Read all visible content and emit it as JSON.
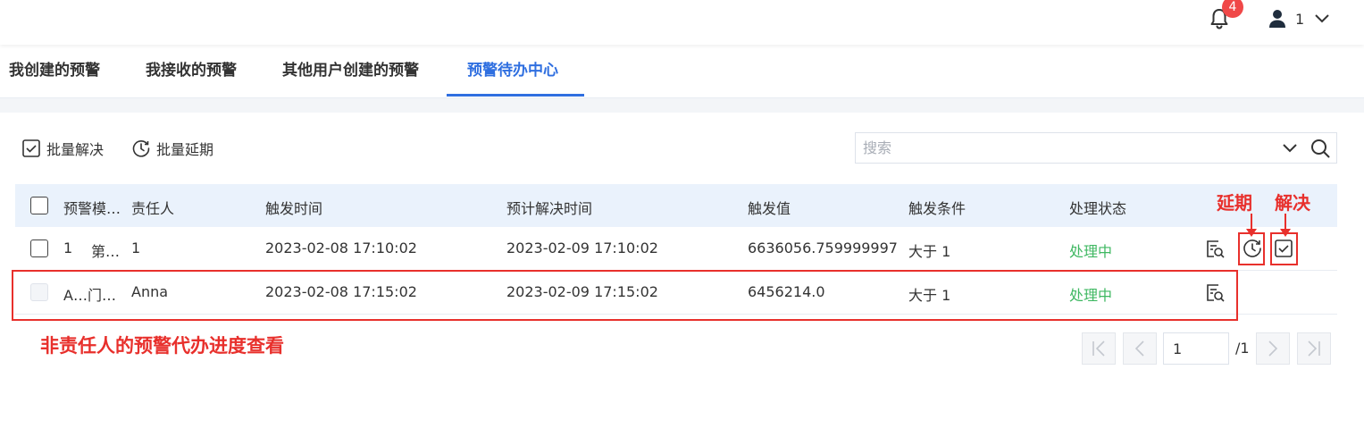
{
  "header": {
    "notification_count": "4",
    "user_name": "1"
  },
  "tabs": [
    {
      "label": "我创建的预警",
      "active": false
    },
    {
      "label": "我接收的预警",
      "active": false
    },
    {
      "label": "其他用户创建的预警",
      "active": false
    },
    {
      "label": "预警待办中心",
      "active": true
    }
  ],
  "toolbar": {
    "batch_resolve_label": "批量解决",
    "batch_delay_label": "批量延期",
    "search_placeholder": "搜索"
  },
  "table": {
    "columns": [
      "预警模…",
      "责任人",
      "触发时间",
      "预计解决时间",
      "触发值",
      "触发条件",
      "处理状态"
    ],
    "rows": [
      {
        "id": "1",
        "model": "第…",
        "owner": "1",
        "trigger_time": "2023-02-08 17:10:02",
        "expected_time": "2023-02-09 17:10:02",
        "trigger_value": "6636056.759999997",
        "condition": "大于 1",
        "status": "处理中",
        "actions": [
          "view-detail-icon",
          "delay-icon",
          "resolve-icon"
        ]
      },
      {
        "id": "",
        "model": "A…门…",
        "owner": "Anna",
        "trigger_time": "2023-02-08 17:15:02",
        "expected_time": "2023-02-09 17:15:02",
        "trigger_value": "6456214.0",
        "condition": "大于 1",
        "status": "处理中",
        "actions": [
          "view-detail-icon"
        ]
      }
    ]
  },
  "annotations": {
    "delay": "延期",
    "resolve": "解决",
    "row_note": "非责任人的预警代办进度查看"
  },
  "pagination": {
    "current_page": "1",
    "total_label": "/1"
  },
  "colors": {
    "accent": "#2f6fe0",
    "status_processing": "#3fb862",
    "annotation_red": "#e8302c",
    "badge_red": "#f04848"
  }
}
